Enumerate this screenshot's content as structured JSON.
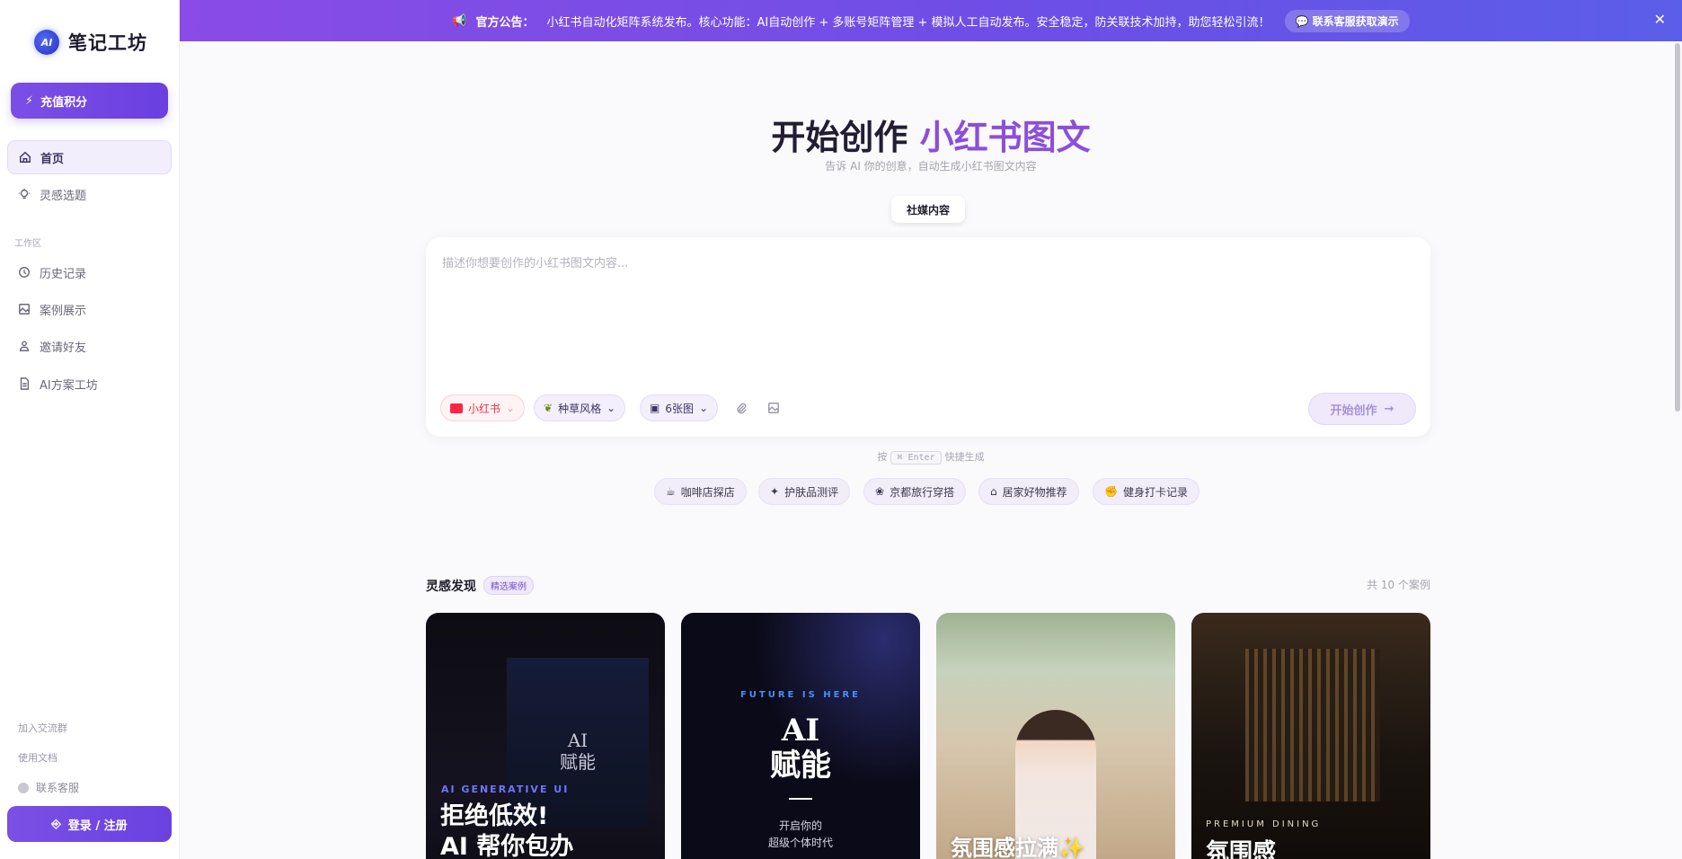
{
  "sidebar": {
    "logo_badge": "AI",
    "logo_text": "笔记工坊",
    "recharge_label": "充值积分",
    "nav": [
      {
        "label": "首页",
        "icon": "home-icon"
      },
      {
        "label": "灵感选题",
        "icon": "bulb-icon"
      }
    ],
    "workspace_label": "工作区",
    "workspace": [
      {
        "label": "历史记录",
        "icon": "clock-icon"
      },
      {
        "label": "案例展示",
        "icon": "image-icon"
      },
      {
        "label": "邀请好友",
        "icon": "users-icon"
      },
      {
        "label": "AI方案工坊",
        "icon": "file-icon"
      }
    ],
    "footer": {
      "join_group": "加入交流群",
      "docs": "使用文档",
      "support": "联系客服"
    },
    "login_label": "登录 / 注册"
  },
  "announcement": {
    "title": "官方公告：",
    "text": "小红书自动化矩阵系统发布。核心功能：AI自动创作 + 多账号矩阵管理 + 模拟人工自动发布。安全稳定，防关联技术加持，助您轻松引流！",
    "button": "联系客服获取演示"
  },
  "hero": {
    "title_main": "开始创作",
    "title_accent": "小红书图文",
    "subtitle": "告诉 AI 你的创意，自动生成小红书图文内容"
  },
  "mode_tab": "社媒内容",
  "editor": {
    "placeholder": "描述你想要创作的小红书图文内容...",
    "platform": "小红书",
    "style": "种草风格",
    "image_count": "6张图",
    "start_label": "开始创作"
  },
  "hint": {
    "prefix": "按",
    "key_symbol": "⌘",
    "key": "Enter",
    "suffix": "快捷生成"
  },
  "suggestions": [
    {
      "label": "咖啡店探店",
      "icon": "☕"
    },
    {
      "label": "护肤品测评",
      "icon": "✦"
    },
    {
      "label": "京都旅行穿搭",
      "icon": "❀"
    },
    {
      "label": "居家好物推荐",
      "icon": "⌂"
    },
    {
      "label": "健身打卡记录",
      "icon": "✊"
    }
  ],
  "inspiration": {
    "title": "灵感发现",
    "badge": "精选案例",
    "count": "共 10 个案例",
    "cards": [
      {
        "tag": "AI GENERATIVE UI",
        "inner_title": "AI\n赋能",
        "title_line1": "拒绝低效!",
        "title_line2": "AI 帮你包办"
      },
      {
        "tag": "FUTURE IS HERE",
        "title_line1": "AI",
        "title_line2": "赋能",
        "small_line1": "开启你的",
        "small_line2": "超级个体时代"
      },
      {
        "title_line1": "氛围感拉满✨"
      },
      {
        "tag": "PREMIUM DINING",
        "title_line1": "氛围感"
      }
    ]
  }
}
